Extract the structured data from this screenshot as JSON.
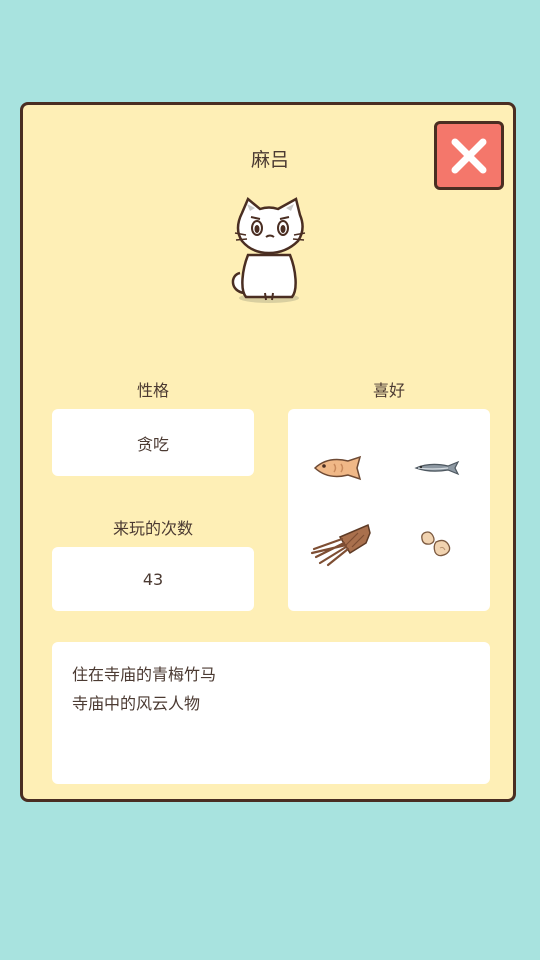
{
  "cat": {
    "name": "麻吕"
  },
  "personality": {
    "label": "性格",
    "value": "贪吃"
  },
  "visits": {
    "label": "来玩的次数",
    "value": "43"
  },
  "favorites": {
    "label": "喜好",
    "items": [
      "fish-icon",
      "sardine-icon",
      "squid-icon",
      "peanut-icon"
    ]
  },
  "description": {
    "line1": "住在寺庙的青梅竹马",
    "line2": "寺庙中的风云人物"
  },
  "colors": {
    "background": "#a8e3df",
    "card": "#feefb6",
    "close_button": "#f4776b",
    "border": "#4a2e22",
    "text": "#4b3a32"
  }
}
